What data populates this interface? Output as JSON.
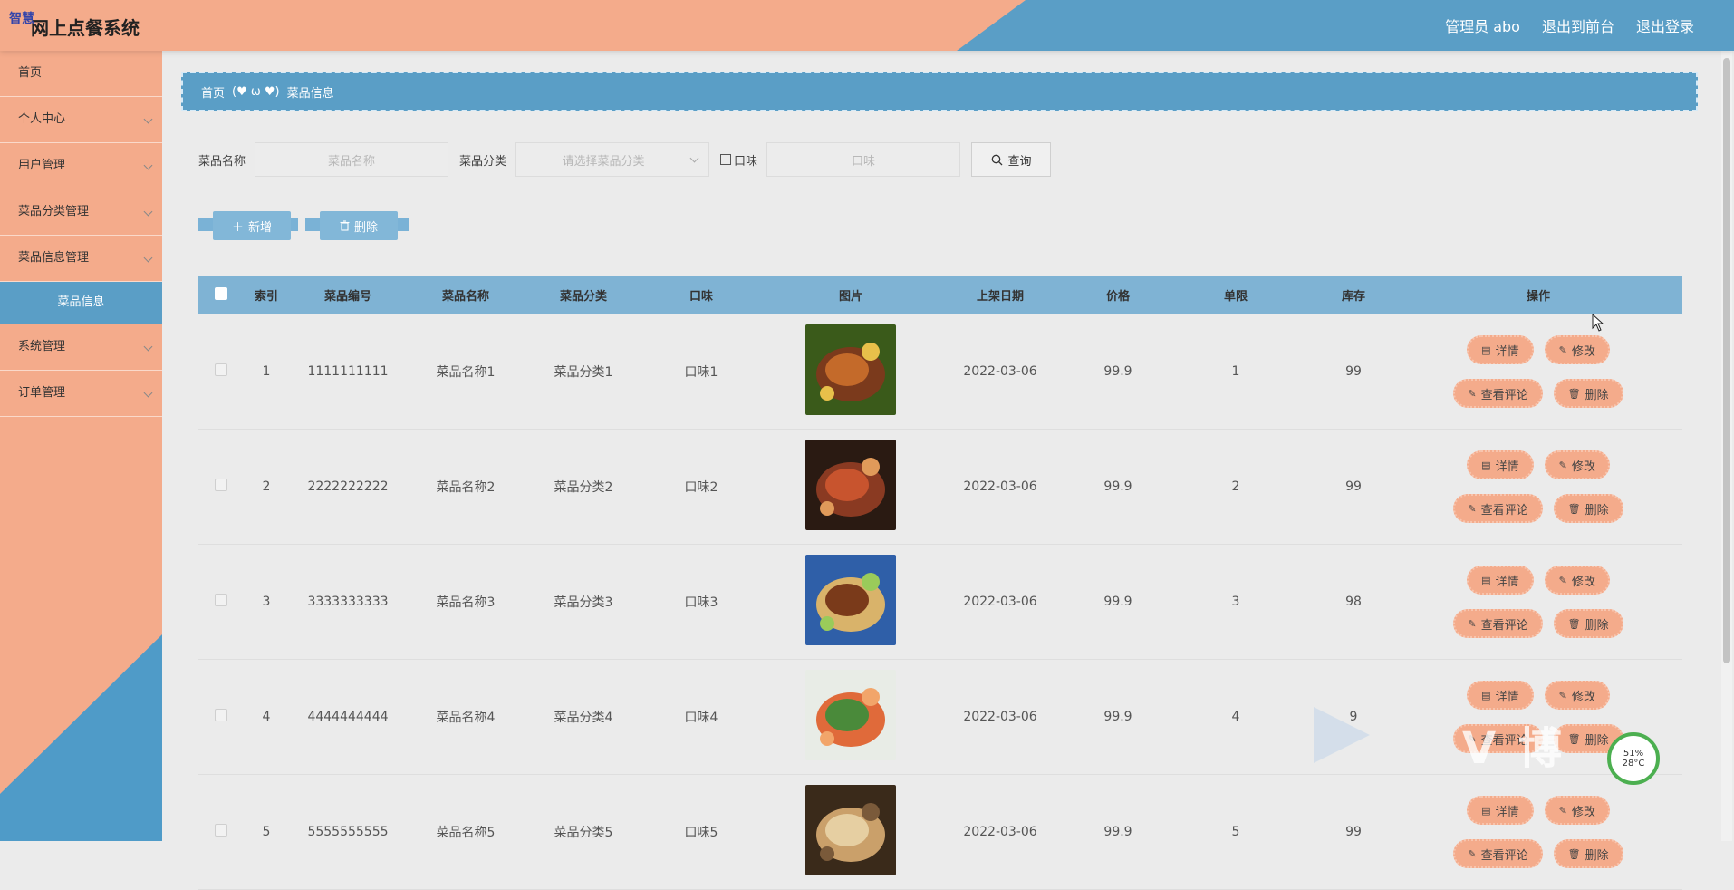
{
  "header": {
    "brand_tag": "智慧",
    "title": "网上点餐系统",
    "admin": "管理员 abo",
    "to_front": "退出到前台",
    "logout": "退出登录"
  },
  "sidebar": {
    "items": [
      {
        "label": "首页",
        "expandable": false
      },
      {
        "label": "个人中心",
        "expandable": true
      },
      {
        "label": "用户管理",
        "expandable": true
      },
      {
        "label": "菜品分类管理",
        "expandable": true
      },
      {
        "label": "菜品信息管理",
        "expandable": true
      },
      {
        "label": "菜品信息",
        "expandable": false,
        "active": true
      },
      {
        "label": "系统管理",
        "expandable": true
      },
      {
        "label": "订单管理",
        "expandable": true
      }
    ]
  },
  "breadcrumb": {
    "home": "首页",
    "separator": "(♥ ω ♥)",
    "current": "菜品信息"
  },
  "search": {
    "name_label": "菜品名称",
    "name_placeholder": "菜品名称",
    "category_label": "菜品分类",
    "category_placeholder": "请选择菜品分类",
    "taste_label": "口味",
    "taste_placeholder": "口味",
    "query_label": "查询"
  },
  "actions": {
    "add_label": "新增",
    "delete_label": "删除"
  },
  "table": {
    "headers": [
      "索引",
      "菜品编号",
      "菜品名称",
      "菜品分类",
      "口味",
      "图片",
      "上架日期",
      "价格",
      "单限",
      "库存",
      "操作"
    ],
    "rows": [
      {
        "index": "1",
        "code": "1111111111",
        "name": "菜品名称1",
        "category": "菜品分类1",
        "taste": "口味1",
        "date": "2022-03-06",
        "price": "99.9",
        "limit": "1",
        "stock": "99"
      },
      {
        "index": "2",
        "code": "2222222222",
        "name": "菜品名称2",
        "category": "菜品分类2",
        "taste": "口味2",
        "date": "2022-03-06",
        "price": "99.9",
        "limit": "2",
        "stock": "99"
      },
      {
        "index": "3",
        "code": "3333333333",
        "name": "菜品名称3",
        "category": "菜品分类3",
        "taste": "口味3",
        "date": "2022-03-06",
        "price": "99.9",
        "limit": "3",
        "stock": "98"
      },
      {
        "index": "4",
        "code": "4444444444",
        "name": "菜品名称4",
        "category": "菜品分类4",
        "taste": "口味4",
        "date": "2022-03-06",
        "price": "99.9",
        "limit": "4",
        "stock": "9"
      },
      {
        "index": "5",
        "code": "5555555555",
        "name": "菜品名称5",
        "category": "菜品分类5",
        "taste": "口味5",
        "date": "2022-03-06",
        "price": "99.9",
        "limit": "5",
        "stock": "99"
      }
    ],
    "op_labels": {
      "detail": "详情",
      "edit": "修改",
      "comments": "查看评论",
      "delete": "删除"
    }
  },
  "overlay": {
    "watermark_text": "V 博",
    "gauge_percent": "51%",
    "gauge_temp": "28°C"
  },
  "colors": {
    "peach": "#f4ab8b",
    "blue": "#5a9ec6",
    "table_header": "#7fb3d4"
  }
}
